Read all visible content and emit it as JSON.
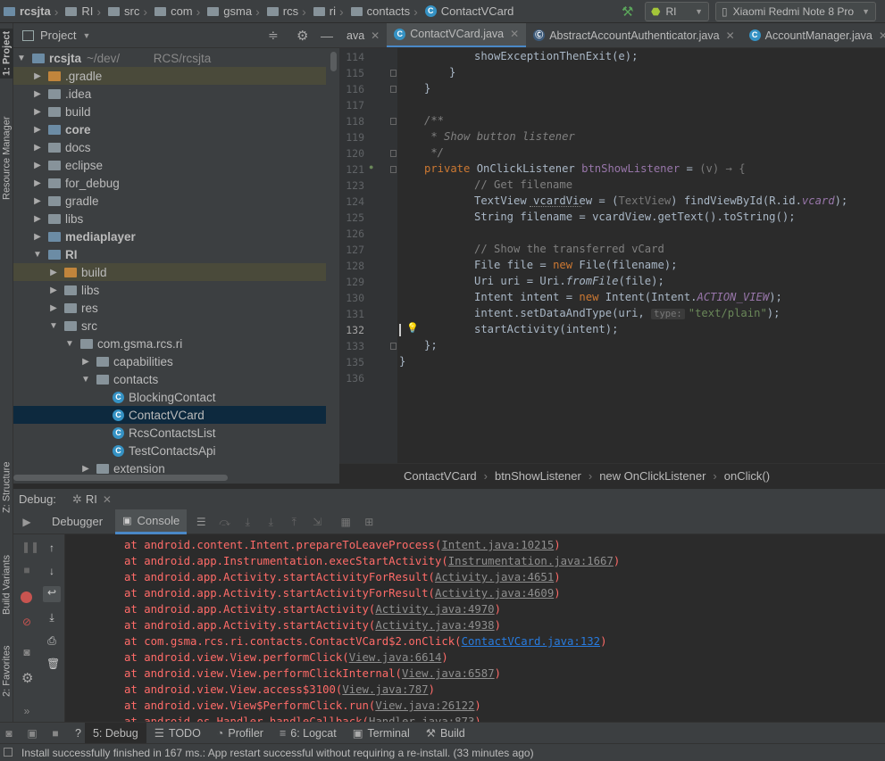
{
  "nav": {
    "crumbs": [
      "rcsjta",
      "RI",
      "src",
      "com",
      "gsma",
      "rcs",
      "ri",
      "contacts",
      "ContactVCard"
    ],
    "run_config": "RI",
    "device": "Xiaomi Redmi Note 8 Pro"
  },
  "left_strip": {
    "project": "1: Project",
    "resource_manager": "Resource Manager",
    "structure": "Z: Structure",
    "build_variants": "Build Variants",
    "favorites": "2: Favorites"
  },
  "project": {
    "title": "Project",
    "items": [
      {
        "label": "rcsjta",
        "extra": "~/dev/          RCS/rcsjta",
        "bold": true
      },
      {
        "label": ".gradle"
      },
      {
        "label": ".idea"
      },
      {
        "label": "build"
      },
      {
        "label": "core",
        "bold": true
      },
      {
        "label": "docs"
      },
      {
        "label": "eclipse"
      },
      {
        "label": "for_debug"
      },
      {
        "label": "gradle"
      },
      {
        "label": "libs"
      },
      {
        "label": "mediaplayer",
        "bold": true
      },
      {
        "label": "RI",
        "bold": true
      },
      {
        "label": "build"
      },
      {
        "label": "libs"
      },
      {
        "label": "res"
      },
      {
        "label": "src"
      },
      {
        "label": "com.gsma.rcs.ri"
      },
      {
        "label": "capabilities"
      },
      {
        "label": "contacts"
      },
      {
        "label": "BlockingContact"
      },
      {
        "label": "ContactVCard"
      },
      {
        "label": "RcsContactsList"
      },
      {
        "label": "TestContactsApi"
      },
      {
        "label": "extension"
      }
    ]
  },
  "editor": {
    "tabs": [
      {
        "label": "ava"
      },
      {
        "label": "ContactVCard.java"
      },
      {
        "label": "AbstractAccountAuthenticator.java"
      },
      {
        "label": "AccountManager.java"
      },
      {
        "label": "Au"
      }
    ],
    "line_numbers": [
      "114",
      "115",
      "116",
      "117",
      "118",
      "119",
      "120",
      "121",
      "123",
      "124",
      "125",
      "126",
      "127",
      "128",
      "129",
      "130",
      "131",
      "132",
      "133",
      "135",
      "136"
    ],
    "lines": {
      "l114": "showExceptionThenExit(e);",
      "l115": "}",
      "l116": "}",
      "l118": "/**",
      "l119": " * Show button listener",
      "l120": " */",
      "l121a": "private ",
      "l121b": "OnClickListener ",
      "l121c": "btnShowListener",
      "l121d": " = ",
      "l121e": "(v) → {",
      "l123": "// Get filename",
      "l124a": "TextView ",
      "l124b": "vcardView",
      "l124c": " = (",
      "l124d": "TextView",
      "l124e": ") findViewById(R.id.",
      "l124f": "vcard",
      "l124g": ");",
      "l125": "String filename = vcardView.getText().toString();",
      "l127": "// Show the transferred vCard",
      "l128a": "File file = ",
      "l128b": "new ",
      "l128c": "File(filename);",
      "l129a": "Uri uri = Uri.",
      "l129b": "fromFile",
      "l129c": "(file);",
      "l130a": "Intent intent = ",
      "l130b": "new ",
      "l130c": "Intent(Intent.",
      "l130d": "ACTION_VIEW",
      "l130e": ");",
      "l131a": "intent.setDataAndType(uri, ",
      "l131b": "type:",
      "l131c": "\"text/plain\"",
      "l131d": ");",
      "l132": "startActivity(intent);",
      "l133": "};",
      "l135": "}"
    },
    "breadcrumb": [
      "ContactVCard",
      "btnShowListener",
      "new OnClickListener",
      "onClick()"
    ]
  },
  "debug": {
    "label": "Debug:",
    "config": "RI",
    "tabs": [
      "Debugger",
      "Console"
    ]
  },
  "console": {
    "lines": [
      {
        "pre": "at android.content.Intent.prepareToLeaveProcess(",
        "link": "Intent.java:10215",
        "post": ")"
      },
      {
        "pre": "at android.app.Instrumentation.execStartActivity(",
        "link": "Instrumentation.java:1667",
        "post": ")"
      },
      {
        "pre": "at android.app.Activity.startActivityForResult(",
        "link": "Activity.java:4651",
        "post": ")"
      },
      {
        "pre": "at android.app.Activity.startActivityForResult(",
        "link": "Activity.java:4609",
        "post": ")"
      },
      {
        "pre": "at android.app.Activity.startActivity(",
        "link": "Activity.java:4970",
        "post": ")"
      },
      {
        "pre": "at android.app.Activity.startActivity(",
        "link": "Activity.java:4938",
        "post": ")"
      },
      {
        "pre": "at com.gsma.rcs.ri.contacts.ContactVCard$2.onClick(",
        "link": "ContactVCard.java:132",
        "post": ")"
      },
      {
        "pre": "at android.view.View.performClick(",
        "link": "View.java:6614",
        "post": ")"
      },
      {
        "pre": "at android.view.View.performClickInternal(",
        "link": "View.java:6587",
        "post": ")"
      },
      {
        "pre": "at android.view.View.access$3100(",
        "link": "View.java:787",
        "post": ")"
      },
      {
        "pre": "at android.view.View$PerformClick.run(",
        "link": "View.java:26122",
        "post": ")"
      },
      {
        "pre": "at android.os.Handler.handleCallback(",
        "link": "Handler.java:873",
        "post": ")"
      }
    ]
  },
  "bottom_tabs": [
    "5: Debug",
    "TODO",
    "Profiler",
    "6: Logcat",
    "Terminal",
    "Build"
  ],
  "status": "Install successfully finished in 167 ms.: App restart successful without requiring a re-install. (33 minutes ago)"
}
